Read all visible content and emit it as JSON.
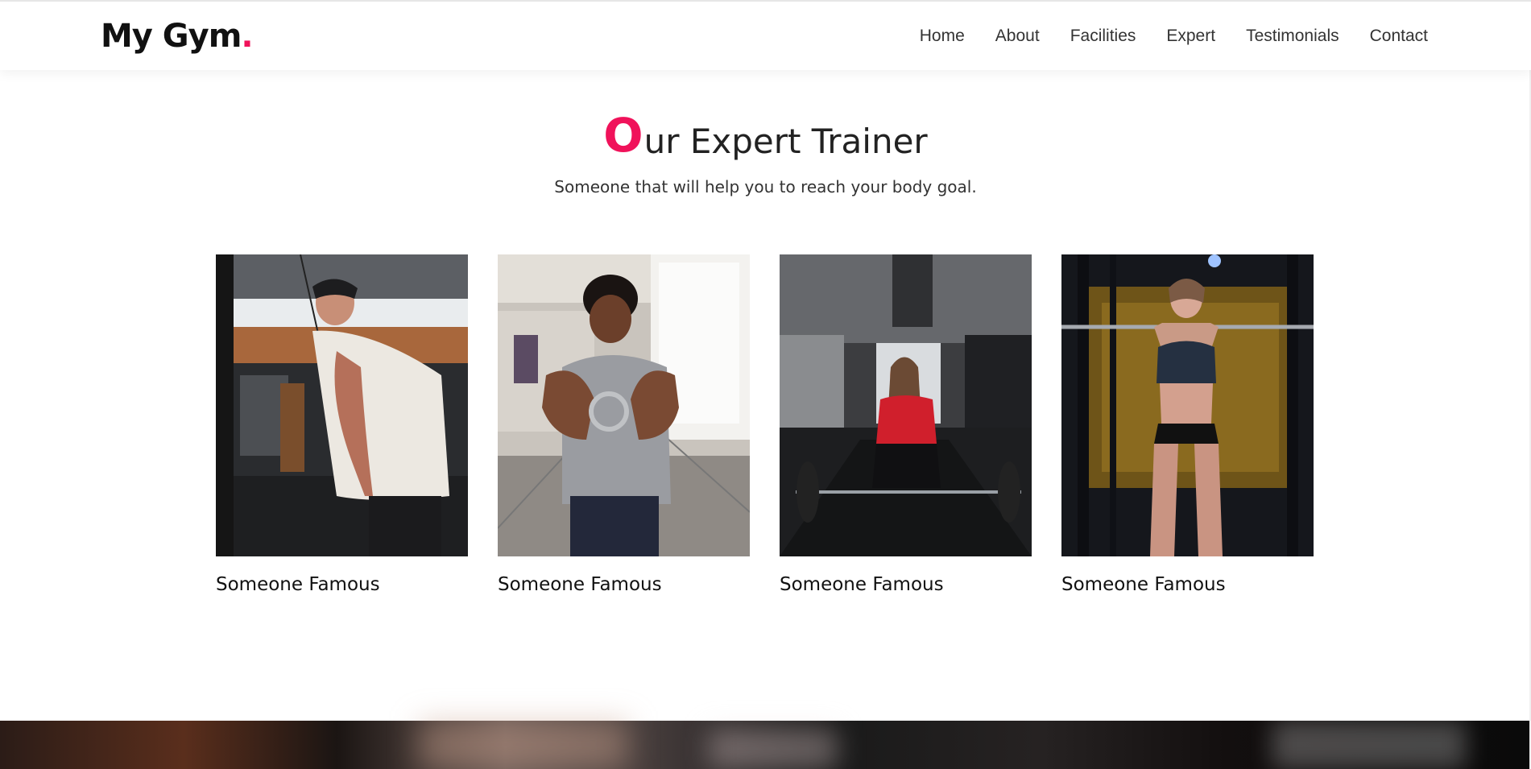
{
  "brand": {
    "name": "My Gym",
    "dot": ".",
    "accent_color": "#f0125a"
  },
  "nav": {
    "items": [
      {
        "label": "Home"
      },
      {
        "label": "About"
      },
      {
        "label": "Facilities"
      },
      {
        "label": "Expert"
      },
      {
        "label": "Testimonials"
      },
      {
        "label": "Contact"
      }
    ]
  },
  "section": {
    "title_first_letter": "O",
    "title_rest": "ur Expert Trainer",
    "subtitle": "Someone that will help you to reach your body goal."
  },
  "trainers": [
    {
      "name": "Someone Famous",
      "photo_icon": "trainer-photo-cable-man"
    },
    {
      "name": "Someone Famous",
      "photo_icon": "trainer-photo-cable-front-man"
    },
    {
      "name": "Someone Famous",
      "photo_icon": "trainer-photo-deadlift-woman"
    },
    {
      "name": "Someone Famous",
      "photo_icon": "trainer-photo-squat-woman"
    }
  ]
}
